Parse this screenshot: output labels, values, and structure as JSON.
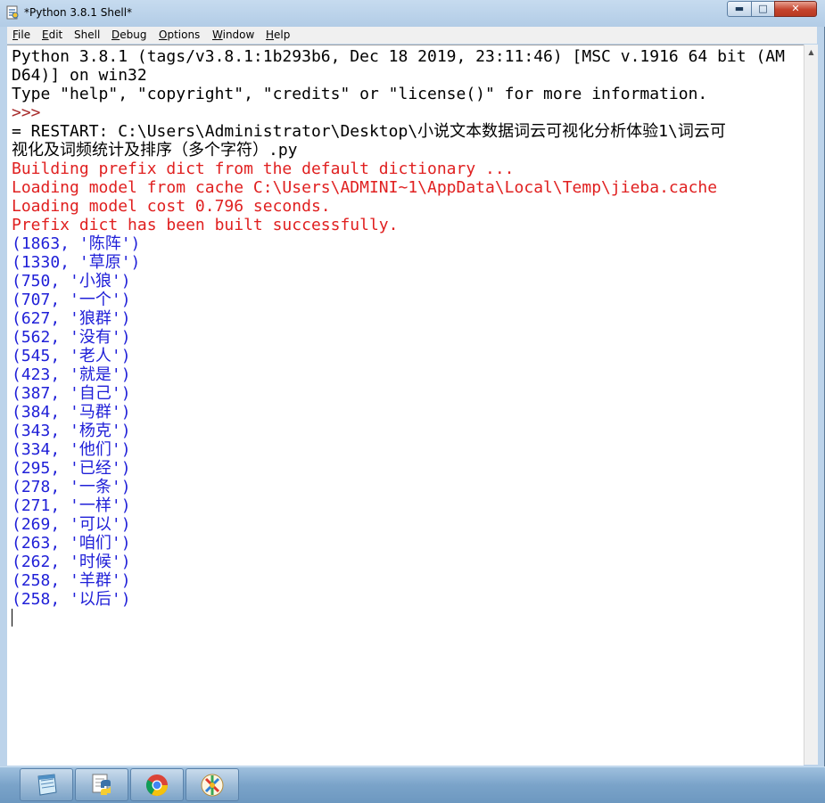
{
  "window": {
    "title": "*Python 3.8.1 Shell*",
    "controls": {
      "minimize": "▬",
      "maximize": "□",
      "close": "✕"
    }
  },
  "menu": [
    {
      "label": "File",
      "key": "F",
      "rest": "ile"
    },
    {
      "label": "Edit",
      "key": "E",
      "rest": "dit"
    },
    {
      "label": "Shell",
      "key": "",
      "rest": "Shell"
    },
    {
      "label": "Debug",
      "key": "D",
      "rest": "ebug"
    },
    {
      "label": "Options",
      "key": "O",
      "rest": "ptions"
    },
    {
      "label": "Window",
      "key": "W",
      "rest": "indow"
    },
    {
      "label": "Help",
      "key": "H",
      "rest": "elp"
    }
  ],
  "shell": {
    "banner_1": "Python 3.8.1 (tags/v3.8.1:1b293b6, Dec 18 2019, 23:11:46) [MSC v.1916 64 bit (AM",
    "banner_2": "D64)] on win32",
    "banner_3": "Type \"help\", \"copyright\", \"credits\" or \"license()\" for more information.",
    "prompt": ">>>",
    "restart_1": "= RESTART: C:\\Users\\Administrator\\Desktop\\小说文本数据词云可视化分析体验1\\词云可",
    "restart_2": "视化及词频统计及排序（多个字符）.py",
    "stderr": [
      "Building prefix dict from the default dictionary ...",
      "Loading model from cache C:\\Users\\ADMINI~1\\AppData\\Local\\Temp\\jieba.cache",
      "Loading model cost 0.796 seconds.",
      "Prefix dict has been built successfully."
    ],
    "output": [
      "(1863, '陈阵')",
      "(1330, '草原')",
      "(750, '小狼')",
      "(707, '一个')",
      "(627, '狼群')",
      "(562, '没有')",
      "(545, '老人')",
      "(423, '就是')",
      "(387, '自己')",
      "(384, '马群')",
      "(343, '杨克')",
      "(334, '他们')",
      "(295, '已经')",
      "(278, '一条')",
      "(271, '一样')",
      "(269, '可以')",
      "(263, '咱们')",
      "(262, '时候')",
      "(258, '羊群')",
      "(258, '以后')"
    ]
  },
  "taskbar": {
    "icons": [
      "notepad-icon",
      "python-icon",
      "chrome-icon",
      "paint-icon"
    ]
  }
}
